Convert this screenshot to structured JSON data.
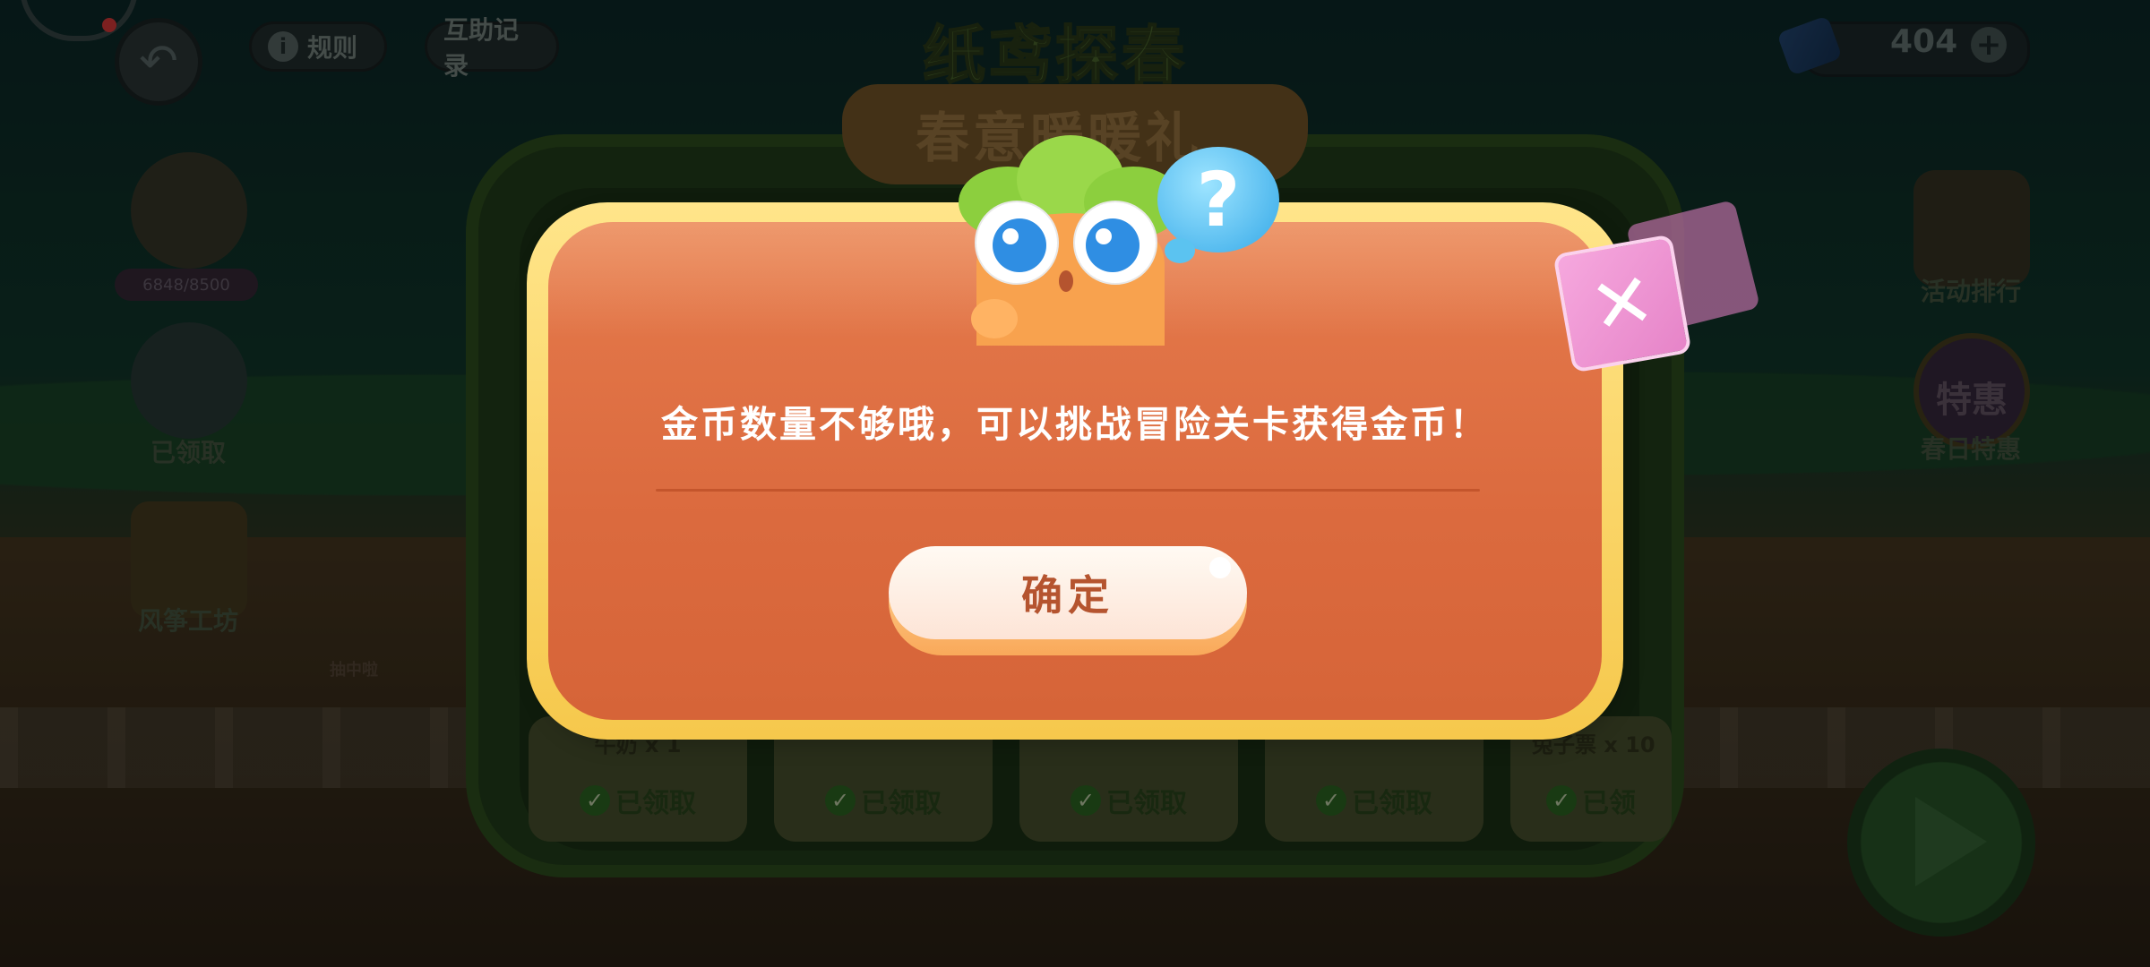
{
  "header": {
    "rules_label": "规则",
    "records_label": "互助记录",
    "title": "纸鸢探春",
    "subtitle": "春意暖暖礼",
    "coins": "404"
  },
  "left_side": {
    "progress": "6848/8500",
    "item_claimed": "已领取",
    "workshop": "风筝工坊",
    "in_lottery": "抽中啦"
  },
  "right_side": {
    "ranking": "活动排行",
    "special_badge": "特惠",
    "spring_deal": "春日特惠"
  },
  "rewards": [
    {
      "name": "牛奶 x 1",
      "status": "已领取"
    },
    {
      "name": "",
      "status": "已领取"
    },
    {
      "name": "",
      "status": "已领取"
    },
    {
      "name": "",
      "status": "已领取"
    },
    {
      "name": "兔子票 x 10",
      "status": "已领"
    }
  ],
  "dialog": {
    "message": "金币数量不够哦，可以挑战冒险关卡获得金币！",
    "confirm_label": "确定",
    "close_symbol": "✕",
    "bubble_symbol": "?"
  },
  "colors": {
    "dialog_body": "#e57a4c",
    "dialog_border": "#f6c84c",
    "confirm_text": "#b5542f",
    "close_button": "#f0a0d8",
    "bubble": "#35a9e8"
  }
}
